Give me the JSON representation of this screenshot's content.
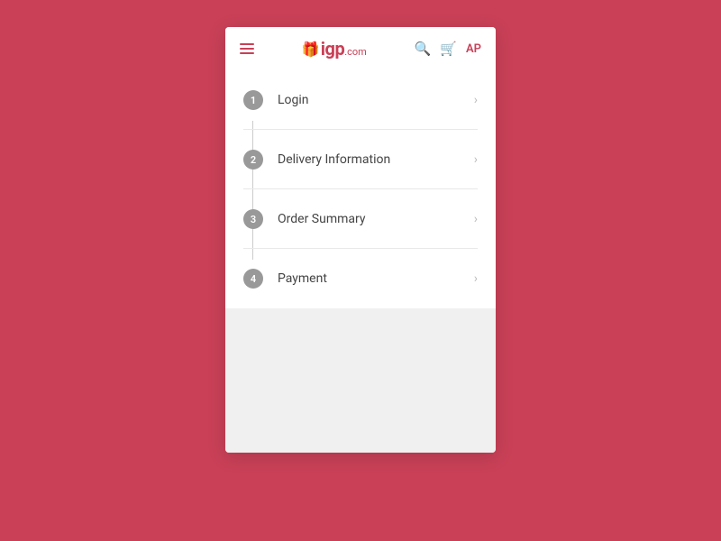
{
  "header": {
    "menu_label": "☰",
    "logo_gift": "🎁",
    "logo_brand": "igp",
    "logo_com": ".com",
    "search_label": "🔍",
    "cart_label": "🛒",
    "user_initials": "AP"
  },
  "steps": [
    {
      "number": "1",
      "label": "Login",
      "id": "login"
    },
    {
      "number": "2",
      "label": "Delivery Information",
      "id": "delivery-information"
    },
    {
      "number": "3",
      "label": "Order Summary",
      "id": "order-summary"
    },
    {
      "number": "4",
      "label": "Payment",
      "id": "payment"
    }
  ],
  "colors": {
    "brand": "#c94057",
    "step_circle": "#999999",
    "step_text": "#444444",
    "divider": "#e8e8e8",
    "chevron": "#bbbbbb",
    "connector_line": "#cccccc"
  }
}
